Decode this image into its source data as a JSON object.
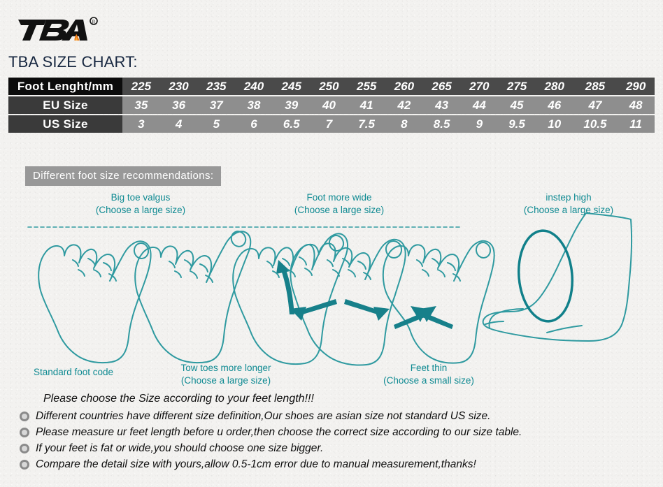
{
  "brand": {
    "logo_text": "TBA",
    "logo_trademark": "®",
    "logo_color": "#111111",
    "logo_accent_color": "#f07c18"
  },
  "title": "TBA SIZE CHART:",
  "title_color": "#16263f",
  "table": {
    "rows": [
      {
        "label": "Foot Lenght/mm",
        "values": [
          "225",
          "230",
          "235",
          "240",
          "245",
          "250",
          "255",
          "260",
          "265",
          "270",
          "275",
          "280",
          "285",
          "290"
        ]
      },
      {
        "label": "EU  Size",
        "values": [
          "35",
          "36",
          "37",
          "38",
          "39",
          "40",
          "41",
          "42",
          "43",
          "44",
          "45",
          "46",
          "47",
          "48"
        ]
      },
      {
        "label": "US  Size",
        "values": [
          "3",
          "4",
          "5",
          "6",
          "6.5",
          "7",
          "7.5",
          "8",
          "8.5",
          "9",
          "9.5",
          "10",
          "10.5",
          "11"
        ]
      }
    ],
    "header_label_bg": "#0c0c0c",
    "header_cell_bg": "#4a4a4a",
    "row_label_bg": "#3a3a3a",
    "row_cell_bg": "#8e8e8e",
    "text_color": "#ffffff"
  },
  "recommendations_badge": {
    "label": "Different  foot  size  recommendations:",
    "bg": "#989898",
    "color": "#ffffff"
  },
  "diagram": {
    "line_color": "#2f9aa0",
    "accent_color": "#0f8a92",
    "guideline_color": "#2f9aa0",
    "captions": {
      "valgus": {
        "line1": "Big toe valgus",
        "line2": "(Choose a large size)"
      },
      "wide": {
        "line1": "Foot more wide",
        "line2": "(Choose a large size)"
      },
      "instep": {
        "line1": "instep high",
        "line2": "(Choose a large size)"
      },
      "standard": {
        "line1": "Standard  foot  code",
        "line2": ""
      },
      "twotoes": {
        "line1": "Tow toes more longer",
        "line2": "(Choose a large size)"
      },
      "thin": {
        "line1": "Feet  thin",
        "line2": "(Choose a small size)"
      }
    }
  },
  "notes": {
    "heading": "Please choose the Size according to  your feet length!!!",
    "bullet_color": "#8a8a8a",
    "items": [
      "Different countries have different size definition,Our shoes are asian size not standard US size.",
      "Please measure ur feet length before u order,then choose the correct size according to our size table.",
      "If your feet is fat or wide,you should choose one size bigger.",
      "Compare the detail size with yours,allow 0.5-1cm error due to manual measurement,thanks!"
    ]
  }
}
